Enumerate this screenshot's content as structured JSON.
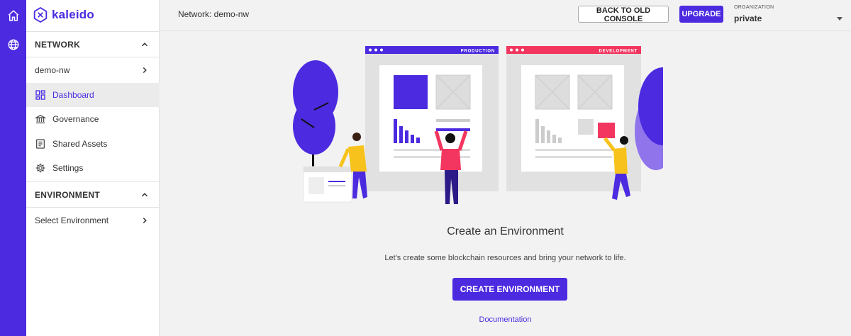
{
  "brand": {
    "name": "kaleido",
    "accent": "#4b2ae0",
    "development_color": "#f2365f",
    "figure_color": "#f7c21b"
  },
  "rail": {
    "icons": [
      "home-icon",
      "globe-icon"
    ]
  },
  "sidebar": {
    "network_section": "NETWORK",
    "network_name": "demo-nw",
    "items": [
      {
        "label": "Dashboard",
        "icon": "dashboard-icon",
        "active": true
      },
      {
        "label": "Governance",
        "icon": "bank-icon"
      },
      {
        "label": "Shared Assets",
        "icon": "document-icon"
      },
      {
        "label": "Settings",
        "icon": "gear-icon"
      }
    ],
    "environment_section": "ENVIRONMENT",
    "environment_select": "Select Environment"
  },
  "topbar": {
    "network_title": "Network: demo-nw",
    "old_console_label": "BACK TO OLD CONSOLE",
    "upgrade_label": "UPGRADE",
    "org_label": "ORGANIZATION",
    "org_value": "private"
  },
  "illustration": {
    "production_label": "PRODUCTION",
    "development_label": "DEVELOPMENT"
  },
  "main": {
    "title": "Create an Environment",
    "description": "Let's create some blockchain resources and bring your network to life.",
    "create_label": "CREATE ENVIRONMENT",
    "doc_label": "Documentation"
  }
}
